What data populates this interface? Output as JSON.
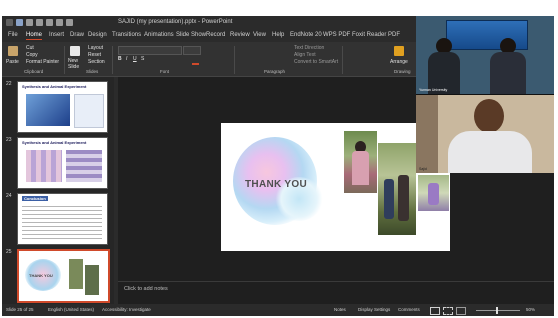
{
  "app": {
    "title": "SAJID (my presentation).pptx - PowerPoint"
  },
  "quick_access_icons": [
    "save-icon",
    "undo-icon",
    "redo-icon",
    "refresh-icon",
    "present-icon",
    "comments-icon"
  ],
  "ribbon_tabs": [
    "File",
    "Home",
    "Insert",
    "Draw",
    "Design",
    "Transitions",
    "Animations",
    "Slide Show",
    "Record",
    "Review",
    "View",
    "Help",
    "EndNote 20",
    "WPS PDF",
    "Foxit Reader PDF"
  ],
  "ribbon": {
    "clipboard": {
      "paste": "Paste",
      "cut": "Cut",
      "copy": "Copy",
      "format_painter": "Format Painter",
      "group": "Clipboard"
    },
    "slides": {
      "new_slide": "New Slide",
      "layout": "Layout",
      "reset": "Reset",
      "section": "Section",
      "group": "Slides"
    },
    "font": {
      "group": "Font"
    },
    "paragraph": {
      "group": "Paragraph",
      "text_direction": "Text Direction",
      "align_text": "Align Text",
      "convert": "Convert to SmartArt"
    },
    "drawing": {
      "arrange": "Arrange",
      "group": "Drawing"
    }
  },
  "thumbnails": [
    {
      "num": "22",
      "title": "Synthesis and Animal Experiment"
    },
    {
      "num": "23",
      "title": "Synthesis and Animal Experiment"
    },
    {
      "num": "24",
      "title": "Conclusion"
    },
    {
      "num": "25",
      "title": "THANK YOU"
    }
  ],
  "slide": {
    "title": "THANK YOU"
  },
  "notes": {
    "placeholder": "Click to add notes"
  },
  "status": {
    "slide_count": "Slide 25 of 25",
    "language": "English (United States)",
    "accessibility": "Accessibility: Investigate",
    "notes": "Notes",
    "display": "Display Settings",
    "comments": "Comments",
    "zoom": "50%"
  },
  "video_call": {
    "top_label": "Yunnan University",
    "bottom_label": "Sajid"
  },
  "colors": {
    "accent": "#d04a2b",
    "window_bg": "#1f1f1f",
    "slide_bg": "#ffffff"
  }
}
